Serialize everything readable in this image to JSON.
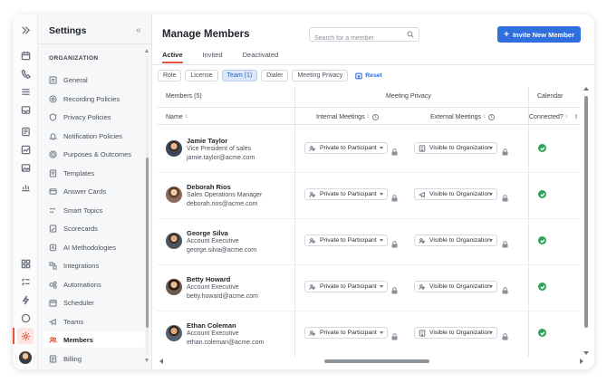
{
  "colors": {
    "accent": "#e5533d",
    "primary_button": "#2f6fde",
    "connected": "#2da45a",
    "chip_active_bg": "#dbe7fb"
  },
  "rail": {
    "icons": [
      "expand-icon",
      "calendar-icon",
      "phone-icon",
      "list-icon",
      "inbox-icon",
      "notes-icon",
      "chart-icon",
      "image-icon",
      "trend-icon",
      "apps-icon",
      "tasks-icon",
      "bolt-icon",
      "more-icon",
      "gear-icon",
      "user-avatar"
    ],
    "active": "gear-icon"
  },
  "sidebar": {
    "title": "Settings",
    "collapse_glyph": "«",
    "section": "ORGANIZATION",
    "items": [
      {
        "label": "General",
        "icon": "general-icon"
      },
      {
        "label": "Recording Policies",
        "icon": "recording-icon"
      },
      {
        "label": "Privacy Policies",
        "icon": "privacy-icon"
      },
      {
        "label": "Notification Policies",
        "icon": "notification-icon"
      },
      {
        "label": "Purposes & Outcomes",
        "icon": "target-icon"
      },
      {
        "label": "Templates",
        "icon": "template-icon"
      },
      {
        "label": "Answer Cards",
        "icon": "cards-icon"
      },
      {
        "label": "Smart Topics",
        "icon": "topics-icon"
      },
      {
        "label": "Scorecards",
        "icon": "scorecard-icon"
      },
      {
        "label": "AI Methodologies",
        "icon": "ai-icon"
      },
      {
        "label": "Integrations",
        "icon": "integrations-icon"
      },
      {
        "label": "Automations",
        "icon": "automations-icon"
      },
      {
        "label": "Scheduler",
        "icon": "scheduler-icon"
      },
      {
        "label": "Teams",
        "icon": "teams-icon"
      },
      {
        "label": "Members",
        "icon": "members-icon",
        "active": true
      },
      {
        "label": "Billing",
        "icon": "billing-icon"
      }
    ]
  },
  "main": {
    "title": "Manage Members",
    "search_placeholder": "Search for a member",
    "invite_label": "Invite New Member",
    "invite_plus": "+",
    "tabs": [
      {
        "label": "Active",
        "active": true
      },
      {
        "label": "Invited"
      },
      {
        "label": "Deactivated"
      }
    ],
    "filters": [
      {
        "label": "Role"
      },
      {
        "label": "License"
      },
      {
        "label": "Team (1)",
        "active": true
      },
      {
        "label": "Dialer"
      },
      {
        "label": "Meeting Privacy"
      }
    ],
    "reset_label": "Reset"
  },
  "table": {
    "group_members": "Members (5)",
    "group_privacy": "Meeting Privacy",
    "group_calendar": "Calendar",
    "col_name": "Name",
    "col_internal": "Internal Meetings",
    "col_external": "External Meetings",
    "col_connected": "Connected?",
    "col_overflow": "I",
    "sort_glyph": "↕",
    "info_glyph": "i",
    "rows": [
      {
        "name": "Jamie Taylor",
        "role": "Vice President of sales",
        "email": "jamie.taylor@acme.com",
        "internal": "Private to Participant",
        "external": "Visible to Organization",
        "connected": true
      },
      {
        "name": "Deborah Rios",
        "role": "Sales Operations Manager",
        "email": "deborah.rios@acme.com",
        "internal": "Private to Participant",
        "external": "Visible to Organization",
        "connected": true
      },
      {
        "name": "George Silva",
        "role": "Account Executive",
        "email": "george.silva@acme.com",
        "internal": "Private to Participant",
        "external": "Visible to Organization",
        "connected": true
      },
      {
        "name": "Betty Howard",
        "role": "Account Executive",
        "email": "betty.howard@acme.com",
        "internal": "Private to Participant",
        "external": "Visible to Organization",
        "connected": true
      },
      {
        "name": "Ethan Coleman",
        "role": "Account Executive",
        "email": "ethan.coleman@acme.com",
        "internal": "Private to Participant",
        "external": "Visible to Organization",
        "connected": true
      }
    ]
  }
}
